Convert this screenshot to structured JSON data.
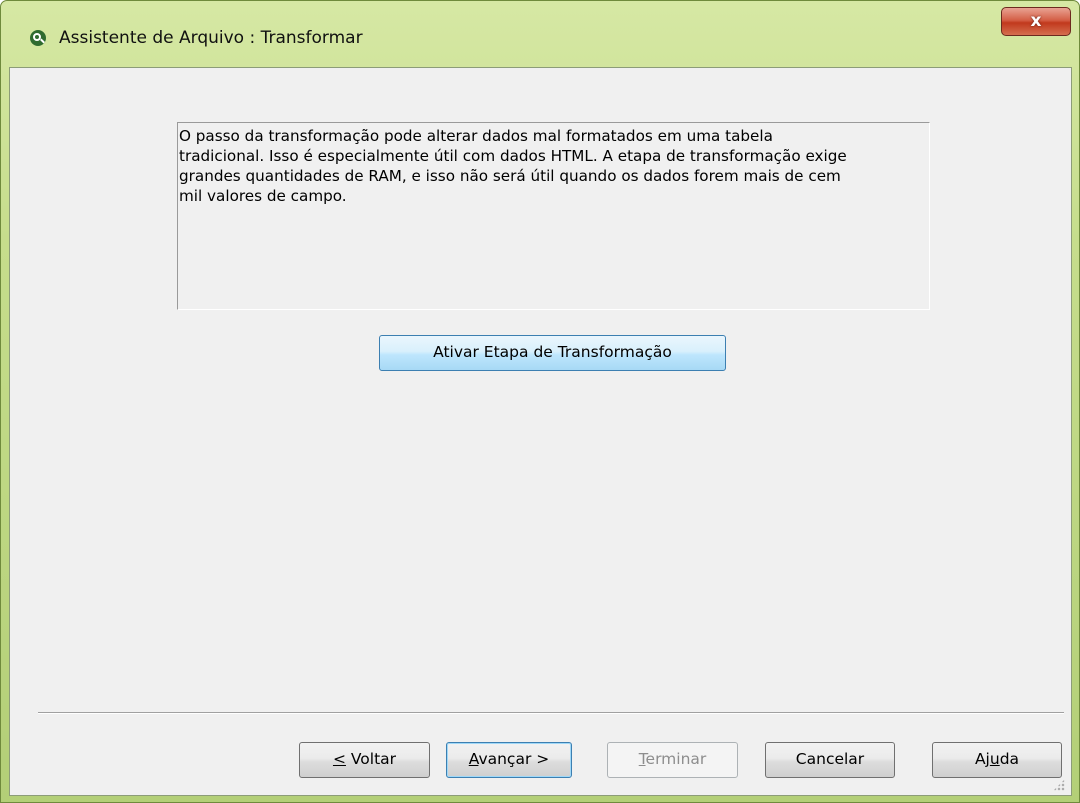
{
  "window": {
    "title": "Assistente de Arquivo : Transformar",
    "close_label": "x"
  },
  "description": "O passo da transformação pode alterar dados mal formatados em uma tabela\ntradicional. Isso é especialmente útil com dados HTML. A etapa de transformação exige\ngrandes quantidades de RAM, e isso não será útil quando os dados forem mais de cem\nmil valores de campo.",
  "enable_button": "Ativar Etapa de Transformação",
  "buttons": {
    "back": {
      "accel": "<",
      "rest": " Voltar"
    },
    "next": {
      "accel": "A",
      "rest": "vançar >"
    },
    "finish": {
      "accel": "T",
      "rest": "erminar",
      "disabled": true
    },
    "cancel": "Cancelar",
    "help": {
      "pre": "Aj",
      "accel": "u",
      "rest": "da"
    }
  },
  "icons": [
    "app-icon",
    "close-icon",
    "resize-grip-icon"
  ],
  "colors": {
    "title_bar": "#c6dd8c",
    "client_background": "#f0f0f0",
    "close_button": "#c1391d",
    "focus_border": "#3c7fb1"
  }
}
